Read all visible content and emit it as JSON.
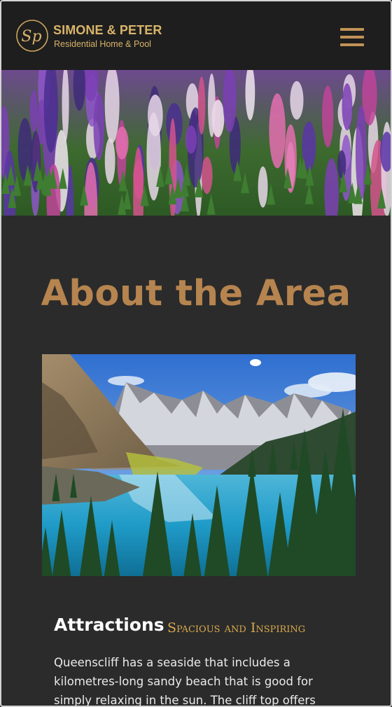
{
  "header": {
    "brand_name": "SIMONE & PETER",
    "brand_subtitle": "Residential Home & Pool",
    "logo_monogram": "Sp",
    "menu_icon": "hamburger-menu-icon"
  },
  "hero": {
    "image_subject": "lupine flower field"
  },
  "about": {
    "title": "About the Area",
    "photo_subject": "mountain lake with pine trees"
  },
  "attractions": {
    "title": "Attractions",
    "tagline": "Spacious and Inspiring",
    "body": "Queenscliff has a seaside that includes a kilometres-long sandy beach that is good for simply relaxing in the sun. The cliff top offers"
  },
  "colors": {
    "header_bg": "#1e1e1e",
    "page_bg": "#2b2b2b",
    "brand_gold": "#d9b46a",
    "heading_bronze": "#b6844f",
    "tagline_gold": "#d9a94e"
  }
}
